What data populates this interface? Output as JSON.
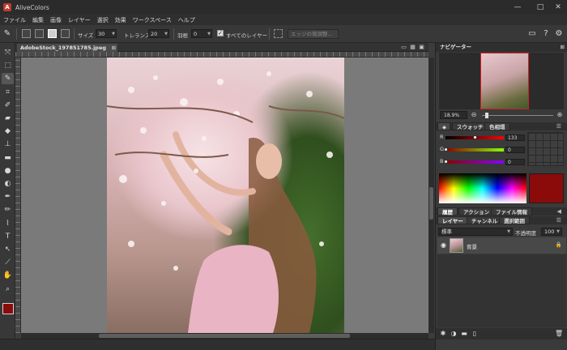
{
  "window": {
    "title": "AliveColors",
    "logo_text": "A",
    "controls": [
      "—",
      "□",
      "✕"
    ]
  },
  "menu": [
    "ファイル",
    "編集",
    "画像",
    "レイヤー",
    "選択",
    "効果",
    "ワークスペース",
    "ヘルプ"
  ],
  "options": {
    "size_label": "サイズ",
    "size_value": "30",
    "tolerance_label": "トレランス",
    "tolerance_value": "20",
    "feather_label": "羽根",
    "feather_value": "0",
    "all_layers_checked": true,
    "all_layers_label": "すべてのレイヤー",
    "edge_refine_label": "エッジの微調整..."
  },
  "right_icons": {
    "chat": "▭",
    "help": "?",
    "settings": "⚙"
  },
  "tools": [
    {
      "name": "move-tool",
      "glyph": "⤧"
    },
    {
      "name": "marquee-tool",
      "glyph": "⬚"
    },
    {
      "name": "magic-wand-tool",
      "glyph": "✎",
      "selected": true
    },
    {
      "name": "crop-tool",
      "glyph": "⌗"
    },
    {
      "name": "brush-tool",
      "glyph": "✐"
    },
    {
      "name": "eraser-tool",
      "glyph": "▰"
    },
    {
      "name": "bucket-tool",
      "glyph": "◆"
    },
    {
      "name": "stamp-tool",
      "glyph": "⊥"
    },
    {
      "name": "gradient-tool",
      "glyph": "▬"
    },
    {
      "name": "blur-tool",
      "glyph": "●"
    },
    {
      "name": "sponge-tool",
      "glyph": "◐"
    },
    {
      "name": "pen-tool",
      "glyph": "✒"
    },
    {
      "name": "pencil-tool",
      "glyph": "✏"
    },
    {
      "name": "smudge-tool",
      "glyph": "⌇"
    },
    {
      "name": "type-tool",
      "glyph": "T"
    },
    {
      "name": "path-tool",
      "glyph": "↖"
    },
    {
      "name": "eyedropper-tool",
      "glyph": "⟋"
    },
    {
      "name": "hand-tool",
      "glyph": "✋"
    },
    {
      "name": "zoom-tool",
      "glyph": "⌕"
    }
  ],
  "foreground_color": "#8b0a0a",
  "document": {
    "tab_name": "AdobeStock_197851785.jpeg",
    "tab_close": "⊠"
  },
  "navigator": {
    "title": "ナビゲーター",
    "zoom": "18.9%",
    "zoom_pct": 0.05
  },
  "color_panel": {
    "tabs": [
      "",
      "スウォッチ",
      "色相環"
    ],
    "channels": [
      {
        "label": "R",
        "value": "133",
        "knob_pct": 0.52
      },
      {
        "label": "G",
        "value": "0",
        "knob_pct": 0.0
      },
      {
        "label": "B",
        "value": "0",
        "knob_pct": 0.0
      }
    ],
    "current_color": "#8b0a0a"
  },
  "history_tabs": [
    "履歴",
    "アクション",
    "ファイル情報"
  ],
  "layers": {
    "tabs": [
      "レイヤー",
      "チャンネル",
      "選択範囲"
    ],
    "blend_mode": "標準",
    "opacity_label": "不透明度",
    "opacity_value": "100",
    "items": [
      {
        "name": "背景",
        "visible": true,
        "locked": true
      }
    ]
  }
}
